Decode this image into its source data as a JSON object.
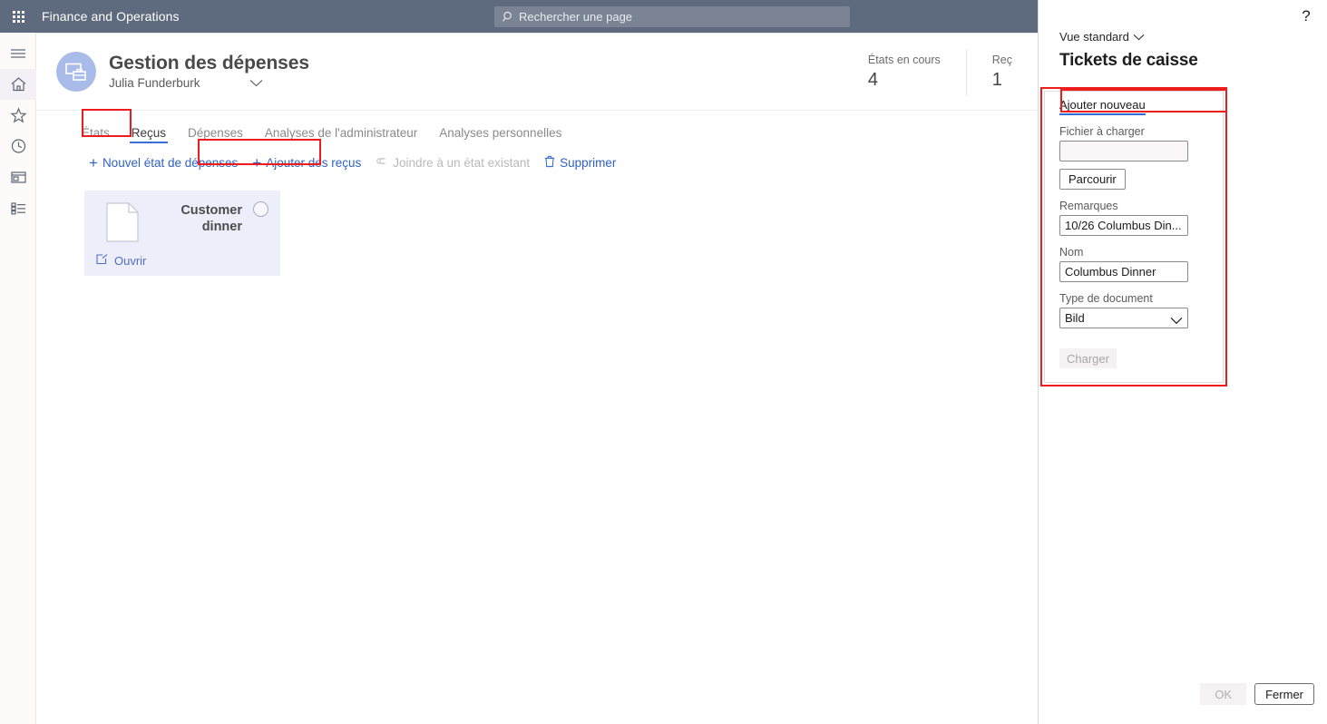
{
  "topbar": {
    "waffle_icon": "app-launcher-icon",
    "app_title": "Finance and Operations",
    "search": {
      "icon": "search-icon",
      "placeholder": "Rechercher une page",
      "value": ""
    },
    "bg_color": "#5e6b7e"
  },
  "sidebar": {
    "items": [
      {
        "icon": "hamburger-menu-icon",
        "name": "navigation-toggle"
      },
      {
        "icon": "home-icon",
        "name": "home",
        "active": true
      },
      {
        "icon": "star-icon",
        "name": "favorites"
      },
      {
        "icon": "clock-icon",
        "name": "recent"
      },
      {
        "icon": "workspaces-icon",
        "name": "workspaces"
      },
      {
        "icon": "list-icon",
        "name": "modules"
      }
    ]
  },
  "header": {
    "workspace_icon": "workspace-expense-icon",
    "title": "Gestion des dépenses",
    "user": "Julia Funderburk",
    "caret_icon": "chevron-down-icon",
    "stats": [
      {
        "label": "États en cours",
        "value": "4"
      },
      {
        "label": "Reç",
        "value": "1"
      }
    ]
  },
  "tabs": [
    {
      "label": "États",
      "selected": false
    },
    {
      "label": "Reçus",
      "selected": true
    },
    {
      "label": "Dépenses",
      "selected": false
    },
    {
      "label": "Analyses de l'administrateur",
      "selected": false
    },
    {
      "label": "Analyses personnelles",
      "selected": false
    }
  ],
  "commandbar": [
    {
      "label": "Nouvel état de dépenses",
      "icon": "plus-icon",
      "disabled": false
    },
    {
      "label": "Ajouter des reçus",
      "icon": "plus-icon",
      "disabled": false
    },
    {
      "label": "Joindre à un état existant",
      "icon": "attach-icon",
      "disabled": true
    },
    {
      "label": "Supprimer",
      "icon": "trash-icon",
      "disabled": false
    }
  ],
  "receipt_cards": [
    {
      "title": "Customer dinner",
      "doc_icon": "document-icon",
      "open_label": "Ouvrir",
      "open_icon": "open-external-icon",
      "selected": false
    }
  ],
  "panel": {
    "help_icon": "help-question-icon",
    "view_selector": "Vue standard",
    "view_caret_icon": "chevron-down-icon",
    "heading": "Tickets de caisse",
    "tab_label": "Ajouter nouveau",
    "fields": {
      "file_label": "Fichier à charger",
      "file_value": "",
      "browse_label": "Parcourir",
      "remarks_label": "Remarques",
      "remarks_value": "10/26 Columbus Din...",
      "name_label": "Nom",
      "name_value": "Columbus Dinner",
      "doctype_label": "Type de document",
      "doctype_value": "Bild",
      "doctype_options": [
        "Bild"
      ],
      "upload_label": "Charger"
    },
    "footer": {
      "ok_label": "OK",
      "close_label": "Fermer"
    }
  },
  "annotations": {
    "highlight_color": "#ee1c1c",
    "boxes": [
      {
        "name": "tab-recus-highlight"
      },
      {
        "name": "add-receipts-highlight"
      },
      {
        "name": "add-new-tab-highlight"
      },
      {
        "name": "upload-form-highlight"
      }
    ]
  }
}
